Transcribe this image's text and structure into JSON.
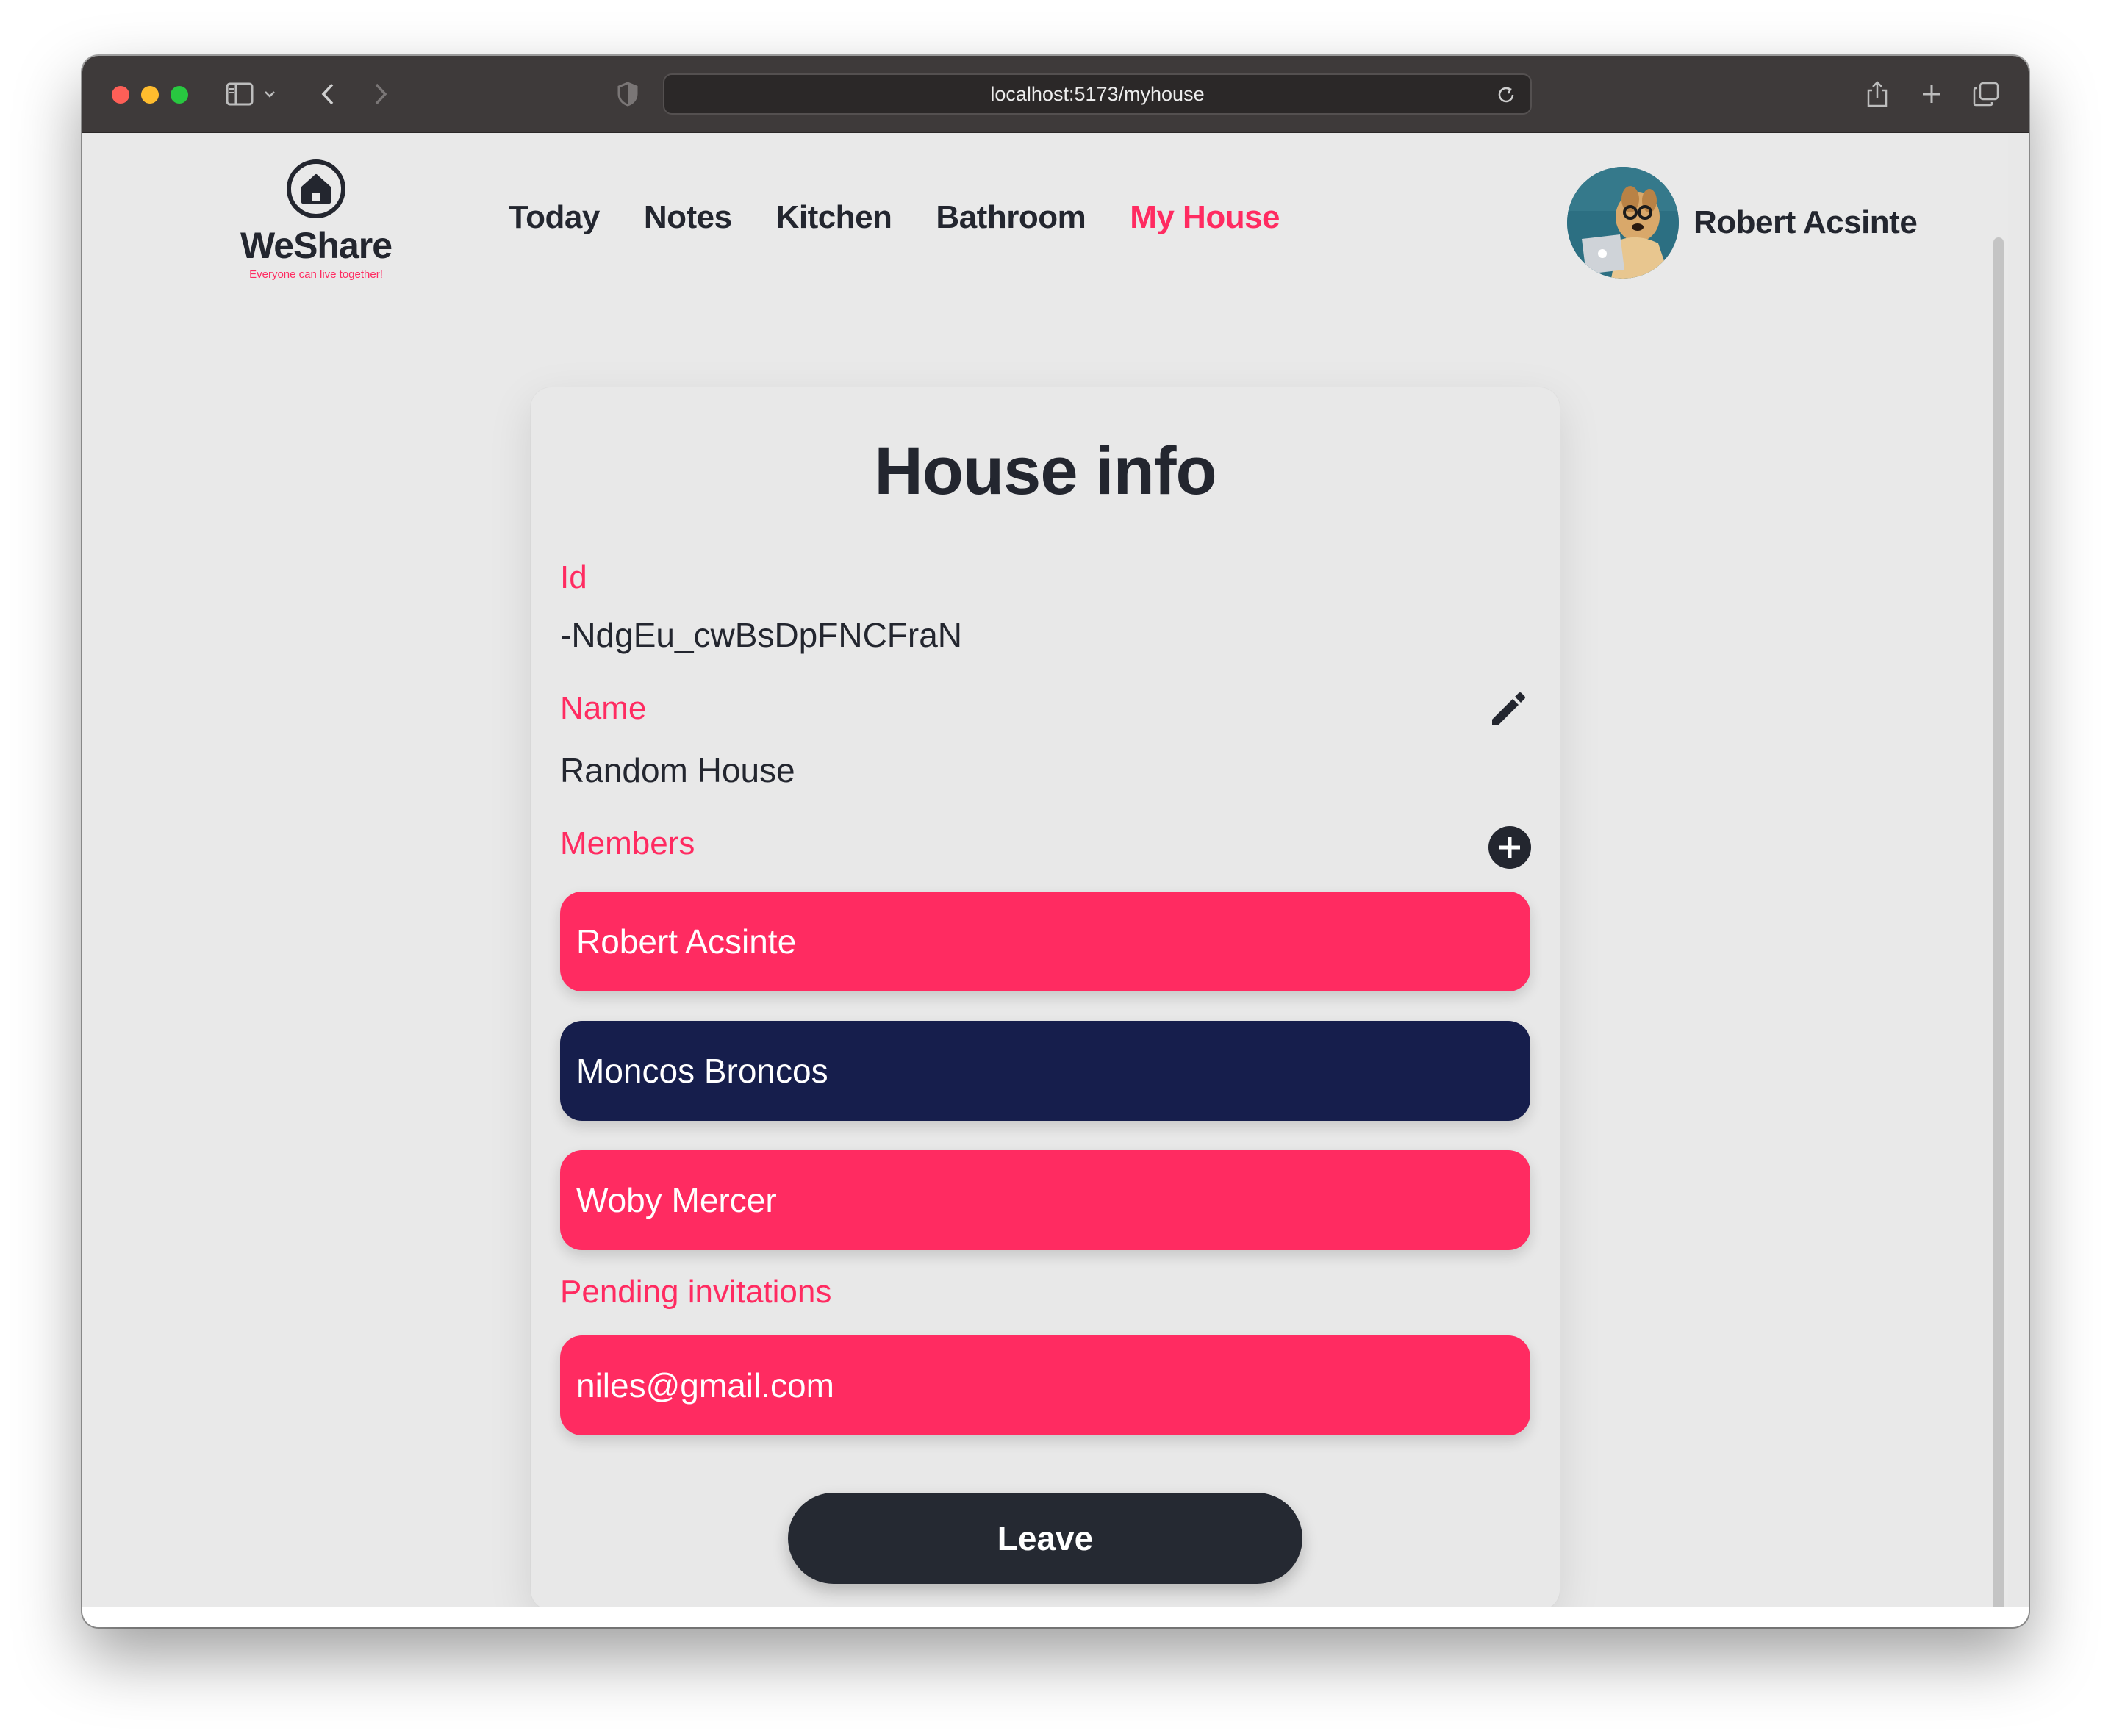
{
  "browser": {
    "url": "localhost:5173/myhouse"
  },
  "brand": {
    "name": "WeShare",
    "tagline": "Everyone can live together!"
  },
  "nav": {
    "items": [
      {
        "label": "Today",
        "active": false
      },
      {
        "label": "Notes",
        "active": false
      },
      {
        "label": "Kitchen",
        "active": false
      },
      {
        "label": "Bathroom",
        "active": false
      },
      {
        "label": "My House",
        "active": true
      }
    ]
  },
  "user": {
    "name": "Robert Acsinte"
  },
  "house": {
    "title": "House info",
    "id_label": "Id",
    "id_value": "-NdgEu_cwBsDpFNCFraN",
    "name_label": "Name",
    "name_value": "Random House",
    "members_label": "Members",
    "members": [
      {
        "name": "Robert Acsinte",
        "color": "#ff2b61"
      },
      {
        "name": "Moncos Broncos",
        "color": "#161e4c"
      },
      {
        "name": "Woby Mercer",
        "color": "#ff2b61"
      }
    ],
    "pending_label": "Pending invitations",
    "pending": [
      {
        "email": "niles@gmail.com"
      }
    ],
    "leave_label": "Leave"
  },
  "colors": {
    "accent": "#ff2b61",
    "dark": "#23262f",
    "navy": "#161e4c",
    "background": "#e9e9e9"
  },
  "icons": {
    "edit": "pencil-icon",
    "add": "plus-circle-icon",
    "logo": "house-icon"
  }
}
